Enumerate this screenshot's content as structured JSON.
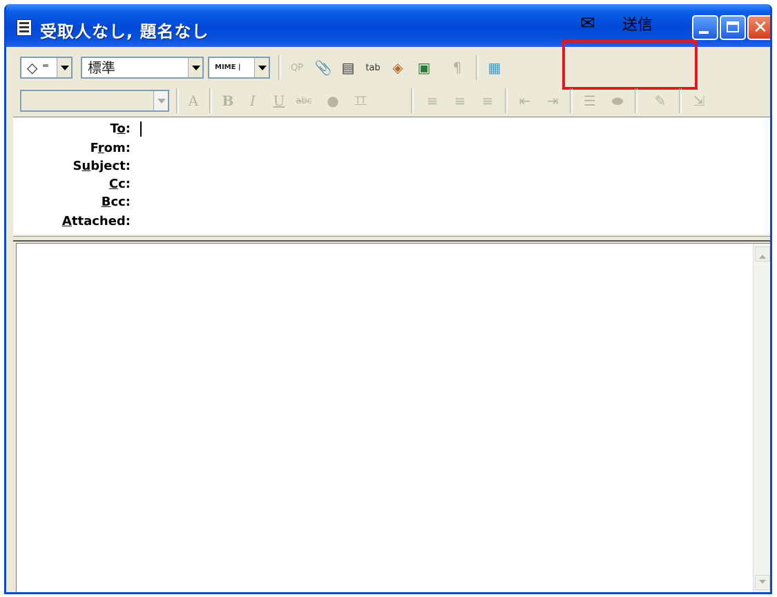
{
  "window": {
    "title": "受取人なし, 題名なし",
    "icon": "document-icon"
  },
  "toolbar1": {
    "priority_combo": "◇ ▾",
    "style_combo": "標準",
    "encoding_combo": "MIME |",
    "send_label": "送信"
  },
  "toolbar2": {
    "font_combo": "",
    "size_label": "A",
    "bold_label": "B",
    "italic_label": "I",
    "underline_label": "U",
    "strike_label": "abc",
    "tt_label": "TT"
  },
  "headers": {
    "to": "To:",
    "from": "From:",
    "subject": "Subject:",
    "cc": "Cc:",
    "bcc": "Bcc:",
    "attached": "Attached:"
  },
  "colors": {
    "highlight": "#e3171d",
    "titlebar": "#0048d6"
  }
}
